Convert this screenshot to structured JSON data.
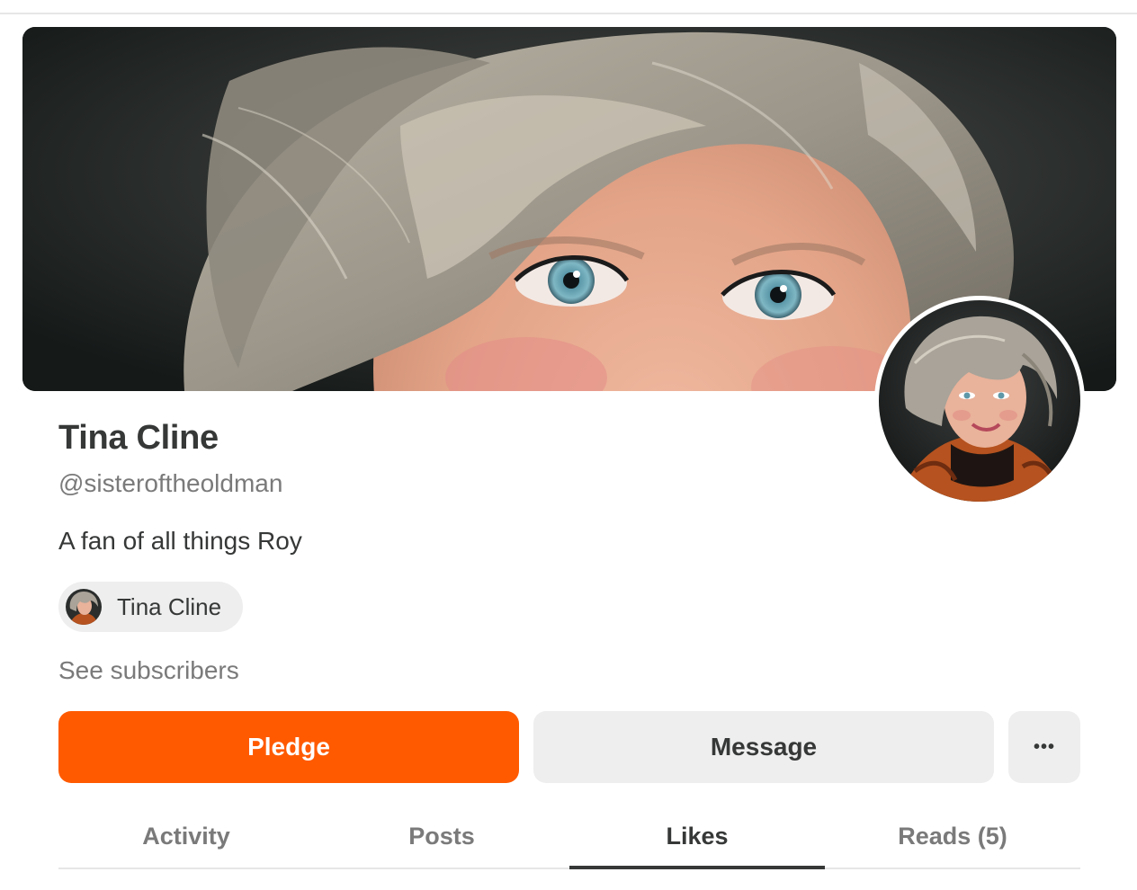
{
  "profile": {
    "name": "Tina Cline",
    "handle": "@sisteroftheoldman",
    "bio": "A fan of all things Roy"
  },
  "publication_chip": {
    "label": "Tina Cline"
  },
  "links": {
    "see_subscribers": "See subscribers"
  },
  "actions": {
    "pledge": "Pledge",
    "message": "Message",
    "more": "•••"
  },
  "tabs": [
    {
      "label": "Activity",
      "active": false
    },
    {
      "label": "Posts",
      "active": false
    },
    {
      "label": "Likes",
      "active": true
    },
    {
      "label": "Reads (5)",
      "active": false
    }
  ],
  "colors": {
    "accent": "#ff5a00",
    "text_primary": "#363737",
    "text_secondary": "#7a7a7a",
    "chip_bg": "#eeeeee"
  }
}
